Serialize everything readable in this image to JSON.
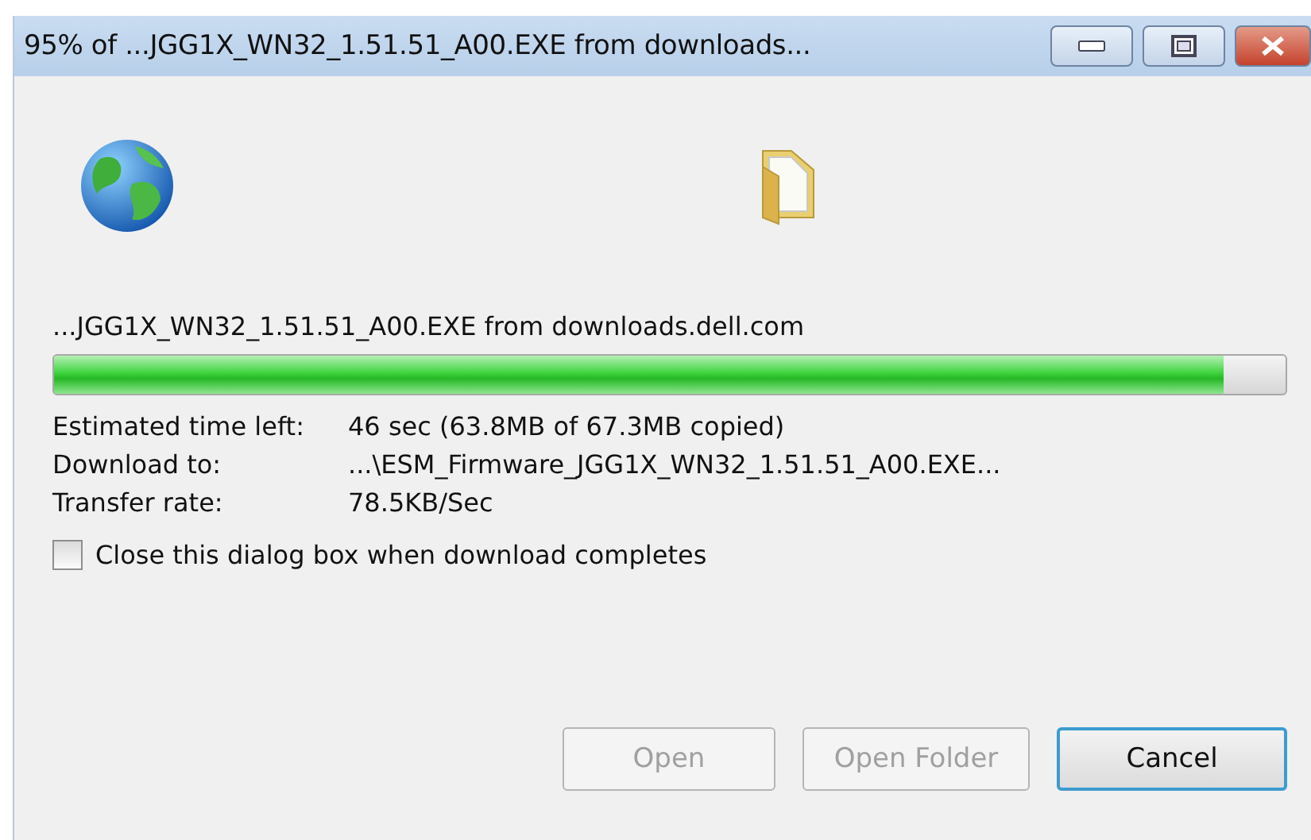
{
  "window": {
    "title": "95% of ...JGG1X_WN32_1.51.51_A00.EXE from downloads..."
  },
  "download": {
    "source": "...JGG1X_WN32_1.51.51_A00.EXE from downloads.dell.com",
    "progress": {
      "level": 0.95
    }
  },
  "details": [
    {
      "label": "Estimated time left:",
      "value": "46 sec (63.8MB of 67.3MB copied)"
    },
    {
      "label": "Download to:",
      "value": "...\\ESM_Firmware_JGG1X_WN32_1.51.51_A00.EXE..."
    },
    {
      "label": "Transfer rate:",
      "value": "78.5KB/Sec"
    }
  ],
  "close_when_done": {
    "label": "Close this dialog box when download completes",
    "checked": false
  },
  "buttons": [
    {
      "label": "Open",
      "disabled": true,
      "default": false
    },
    {
      "label": "Open Folder",
      "disabled": true,
      "default": false
    },
    {
      "label": "Cancel",
      "disabled": false,
      "default": true
    }
  ]
}
